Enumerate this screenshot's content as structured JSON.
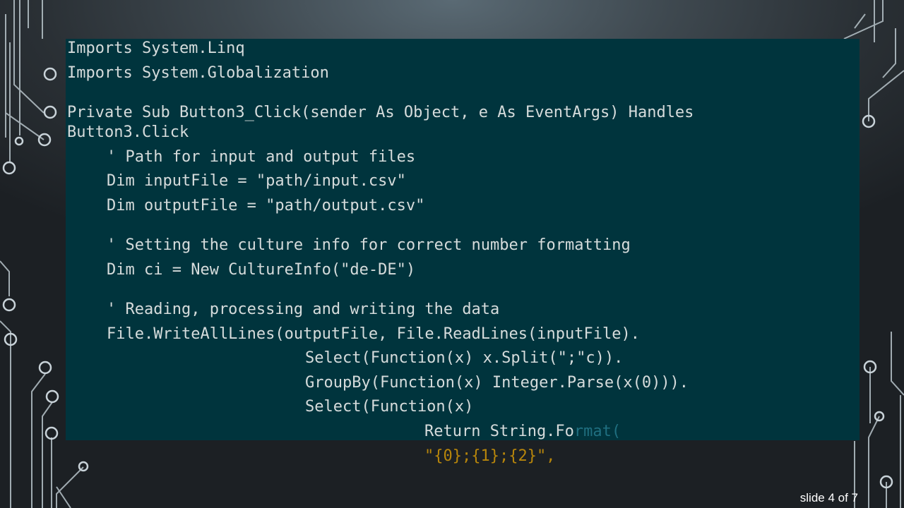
{
  "code": {
    "line1": "Imports System.Linq",
    "line2": "Imports System.Globalization",
    "line3": "Private Sub Button3_Click(sender As Object, e As EventArgs) Handles",
    "line4": "Button3.Click",
    "line5": "' Path for input and output files",
    "line6": "Dim inputFile = \"path/input.csv\"",
    "line7": "Dim outputFile = \"path/output.csv\"",
    "line8": "' Setting the culture info for correct number formatting",
    "line9": "Dim ci = New CultureInfo(\"de-DE\")",
    "line10": "' Reading, processing and writing the data",
    "line11": "File.WriteAllLines(outputFile, File.ReadLines(inputFile).",
    "line12": "Select(Function(x) x.Split(\";\"c)).",
    "line13": "GroupBy(Function(x) Integer.Parse(x(0))).",
    "line14": "Select(Function(x)",
    "line15_main": "Return String.Fo",
    "line15_faded": "rmat(",
    "line16": "\"{0};{1};{2}\","
  },
  "colors": {
    "panel_bg": "#00343d",
    "code_text": "#d6dcdc",
    "overflow_string": "#b8860b",
    "overflow_faded": "#1f6f80"
  },
  "footer": {
    "slide_counter": "slide 4 of 7"
  }
}
